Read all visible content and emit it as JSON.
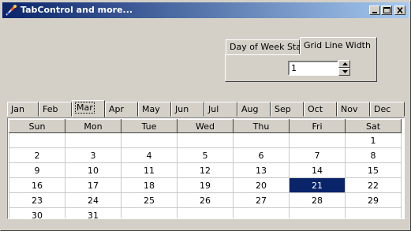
{
  "window": {
    "title": "TabControl and more..."
  },
  "settings_tabs": {
    "tabs": [
      "Day of Week Start",
      "Grid Line Width"
    ],
    "active_index": 1
  },
  "grid_line_width": {
    "value": "1"
  },
  "months": [
    "Jan",
    "Feb",
    "Mar",
    "Apr",
    "May",
    "Jun",
    "Jul",
    "Aug",
    "Sep",
    "Oct",
    "Nov",
    "Dec"
  ],
  "active_month_index": 2,
  "calendar": {
    "days_of_week": [
      "Sun",
      "Mon",
      "Tue",
      "Wed",
      "Thu",
      "Fri",
      "Sat"
    ],
    "weeks": [
      [
        "",
        "",
        "",
        "",
        "",
        "",
        "1"
      ],
      [
        "2",
        "3",
        "4",
        "5",
        "6",
        "7",
        "8"
      ],
      [
        "9",
        "10",
        "11",
        "12",
        "13",
        "14",
        "15"
      ],
      [
        "16",
        "17",
        "18",
        "19",
        "20",
        "21",
        "22"
      ],
      [
        "23",
        "24",
        "25",
        "26",
        "27",
        "28",
        "29"
      ],
      [
        "30",
        "31",
        "",
        "",
        "",
        "",
        ""
      ]
    ],
    "selected_day": "21",
    "selected_color": "#0a246a"
  }
}
